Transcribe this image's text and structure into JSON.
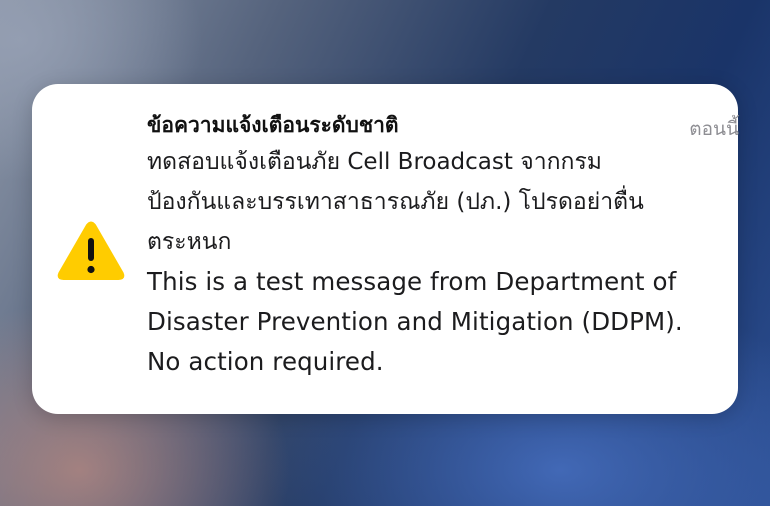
{
  "notification": {
    "title": "ข้อความแจ้งเตือนระดับชาติ",
    "time": "ตอนนี้",
    "icon": "warning-triangle-icon",
    "icon_color": "#FFCC00",
    "body_lines": [
      "ทดสอบแจ้งเตือนภัย Cell Broadcast จากกรม",
      "ป้องกันและบรรเทาสาธารณภัย (ปภ.) โปรดอย่าตื่น",
      "ตระหนก",
      "This is a test message from Department of",
      "Disaster Prevention and Mitigation (DDPM).",
      "No action required."
    ]
  }
}
